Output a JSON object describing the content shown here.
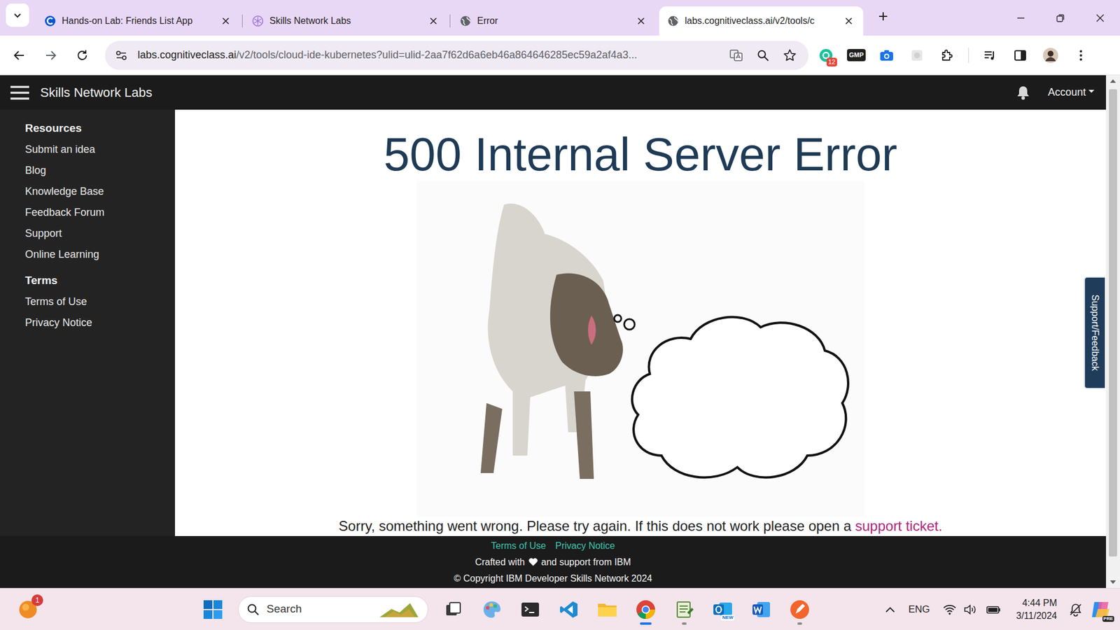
{
  "browser": {
    "tabs": [
      {
        "label": "Hands-on Lab: Friends List App",
        "kind": "course",
        "selected": false
      },
      {
        "label": "Skills Network Labs",
        "kind": "labs",
        "selected": false
      },
      {
        "label": "Error",
        "kind": "globe",
        "selected": false
      },
      {
        "label": "labs.cognitiveclass.ai/v2/tools/c",
        "kind": "globe",
        "selected": true
      }
    ],
    "address": {
      "host": "labs.cognitiveclass.ai",
      "path": "/v2/tools/cloud-ide-kubernetes?ulid=ulid-2aa7f62d6a6eb46a864646285ec59a2af4a3..."
    },
    "extension_badge": "12",
    "extension_label": "GMP"
  },
  "page": {
    "brand": "Skills Network Labs",
    "account": "Account",
    "sidebar": {
      "sections": [
        {
          "heading": "Resources",
          "items": [
            "Submit an idea",
            "Blog",
            "Knowledge Base",
            "Feedback Forum",
            "Support",
            "Online Learning"
          ]
        },
        {
          "heading": "Terms",
          "items": [
            "Terms of Use",
            "Privacy Notice"
          ]
        }
      ]
    },
    "error": {
      "title": "500 Internal Server Error",
      "message": "Sorry, something went wrong. Please try again. If this does not work please open a ",
      "link": "support ticket."
    },
    "footer": {
      "links": [
        "Terms of Use",
        "Privacy Notice"
      ],
      "crafted_before": "Crafted with",
      "crafted_after": "and support from IBM",
      "copyright": "© Copyright IBM Developer Skills Network 2024"
    },
    "feedback_tab": "Support/Feedback"
  },
  "taskbar": {
    "weather_badge": "1",
    "search_placeholder": "Search",
    "apps": [
      {
        "kind": "taskview",
        "running": false,
        "selected": false
      },
      {
        "kind": "paint",
        "running": false,
        "selected": false
      },
      {
        "kind": "terminal",
        "running": false,
        "selected": false
      },
      {
        "kind": "vscode",
        "running": false,
        "selected": false
      },
      {
        "kind": "folder",
        "running": false,
        "selected": false
      },
      {
        "kind": "chrome",
        "running": true,
        "selected": true
      },
      {
        "kind": "notepad",
        "running": true,
        "selected": false
      },
      {
        "kind": "outlook",
        "running": false,
        "selected": false
      },
      {
        "kind": "word",
        "running": false,
        "selected": false
      },
      {
        "kind": "pen",
        "running": true,
        "selected": false
      }
    ],
    "outlook_badge": "NEW",
    "language": "ENG",
    "time": "4:44 PM",
    "date": "3/11/2024",
    "copilot_badge": "PRE"
  }
}
